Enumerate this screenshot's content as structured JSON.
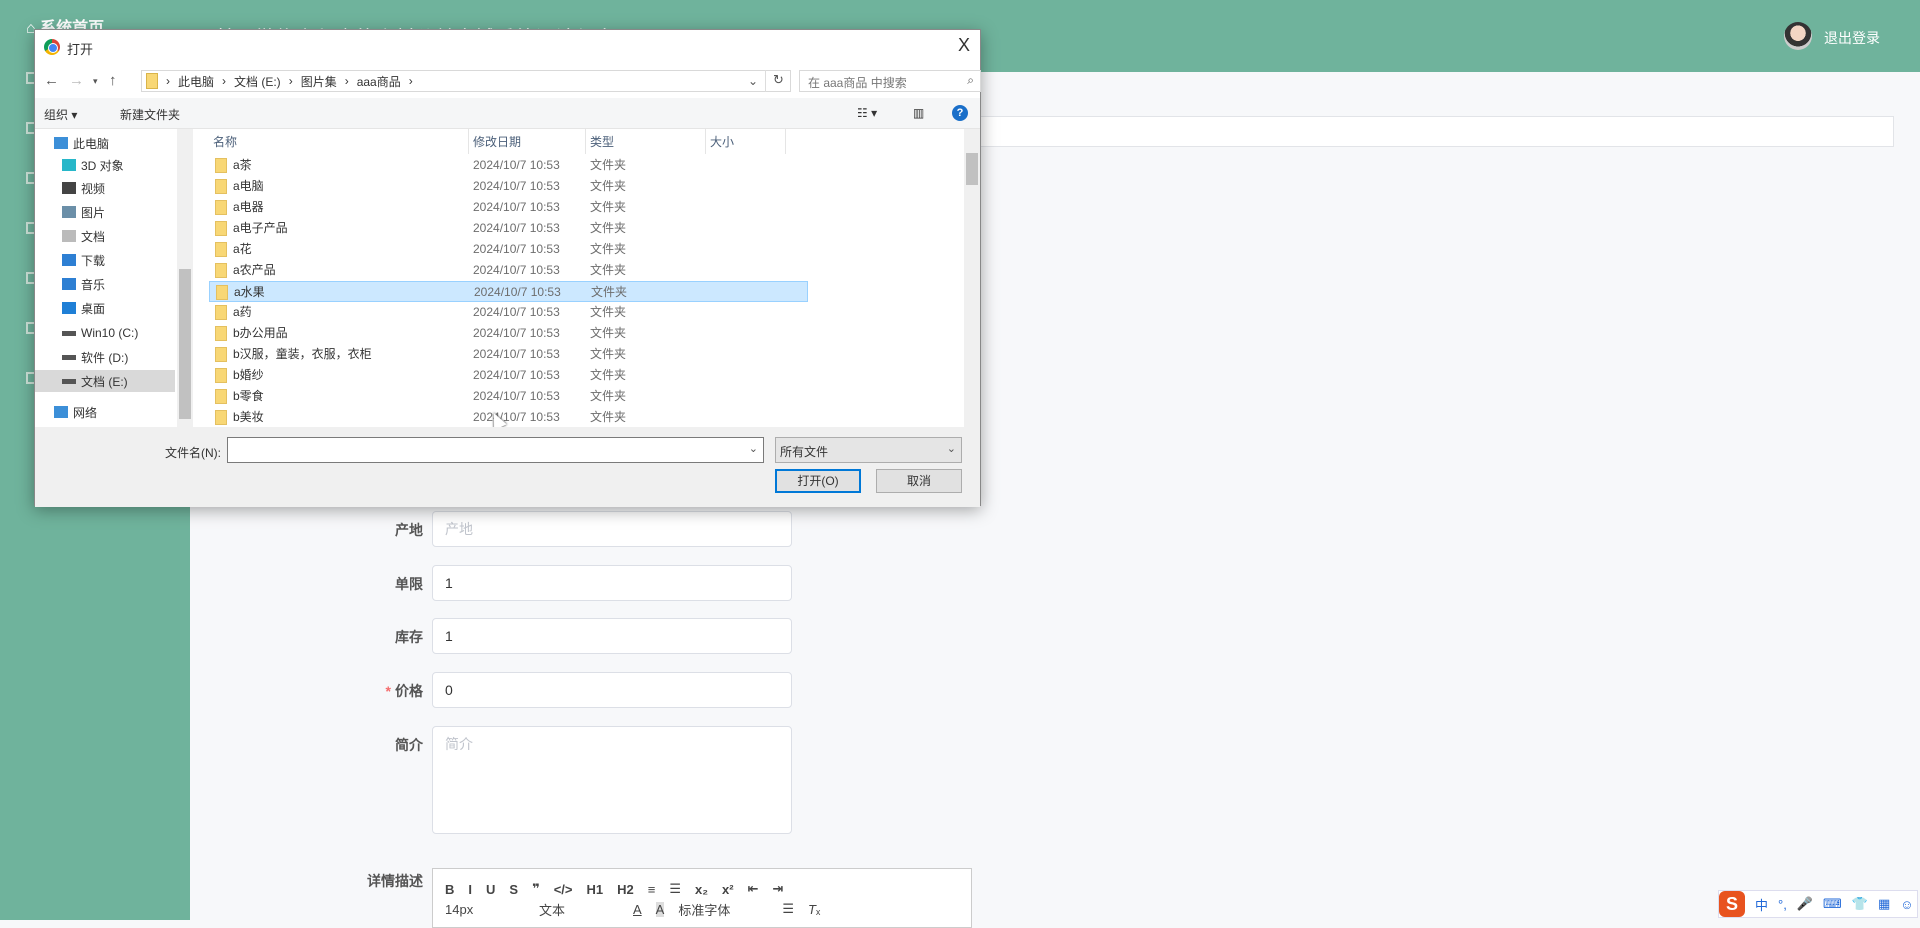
{
  "app": {
    "home_label": "系统首页",
    "title": "基于微信小程序的乡村公益商城系统设计与实现",
    "logout": "退出登录"
  },
  "form": {
    "fields": [
      {
        "label": "产地",
        "value": "",
        "placeholder": "产地",
        "required": false
      },
      {
        "label": "单限",
        "value": "1",
        "placeholder": "",
        "required": false
      },
      {
        "label": "库存",
        "value": "1",
        "placeholder": "",
        "required": false
      },
      {
        "label": "价格",
        "value": "0",
        "placeholder": "",
        "required": true
      },
      {
        "label": "简介",
        "value": "",
        "placeholder": "简介",
        "required": false
      }
    ],
    "required_mark": "*",
    "detail_label": "详情描述",
    "editor": {
      "row1": [
        "B",
        "I",
        "U",
        "S",
        "❞",
        "</>",
        "H1",
        "H2",
        "≡",
        "☰",
        "x₂",
        "x²",
        "⇤",
        "⇥"
      ],
      "font_size": "14px",
      "block": "文本",
      "font": "标准字体"
    }
  },
  "ime": {
    "logo": "S",
    "items": [
      "中",
      "°,",
      "🎤",
      "⌨",
      "👕",
      "▦",
      "☺"
    ]
  },
  "dialog": {
    "title": "打开",
    "close": "X",
    "breadcrumb": [
      "此电脑",
      "文档 (E:)",
      "图片集",
      "aaa商品"
    ],
    "search_placeholder": "在 aaa商品 中搜索",
    "toolbar": {
      "organize": "组织 ▾",
      "new_folder": "新建文件夹"
    },
    "nav": [
      {
        "label": "此电脑",
        "icon": "computer-icon"
      },
      {
        "label": "3D 对象",
        "icon": "cube-icon"
      },
      {
        "label": "视频",
        "icon": "video-icon"
      },
      {
        "label": "图片",
        "icon": "picture-icon"
      },
      {
        "label": "文档",
        "icon": "document-icon"
      },
      {
        "label": "下载",
        "icon": "download-icon"
      },
      {
        "label": "音乐",
        "icon": "music-icon"
      },
      {
        "label": "桌面",
        "icon": "desktop-icon"
      },
      {
        "label": "Win10 (C:)",
        "icon": "drive-icon"
      },
      {
        "label": "软件 (D:)",
        "icon": "drive-icon"
      },
      {
        "label": "文档 (E:)",
        "icon": "drive-icon",
        "selected": true
      },
      {
        "label": "网络",
        "icon": "network-icon"
      }
    ],
    "columns": [
      "名称",
      "修改日期",
      "类型",
      "大小"
    ],
    "files": [
      {
        "name": "a茶",
        "date": "2024/10/7 10:53",
        "type": "文件夹"
      },
      {
        "name": "a电脑",
        "date": "2024/10/7 10:53",
        "type": "文件夹"
      },
      {
        "name": "a电器",
        "date": "2024/10/7 10:53",
        "type": "文件夹"
      },
      {
        "name": "a电子产品",
        "date": "2024/10/7 10:53",
        "type": "文件夹"
      },
      {
        "name": "a花",
        "date": "2024/10/7 10:53",
        "type": "文件夹"
      },
      {
        "name": "a农产品",
        "date": "2024/10/7 10:53",
        "type": "文件夹"
      },
      {
        "name": "a水果",
        "date": "2024/10/7 10:53",
        "type": "文件夹",
        "selected": true
      },
      {
        "name": "a药",
        "date": "2024/10/7 10:53",
        "type": "文件夹"
      },
      {
        "name": "b办公用品",
        "date": "2024/10/7 10:53",
        "type": "文件夹"
      },
      {
        "name": "b汉服，童装，衣服，衣柜",
        "date": "2024/10/7 10:53",
        "type": "文件夹"
      },
      {
        "name": "b婚纱",
        "date": "2024/10/7 10:53",
        "type": "文件夹"
      },
      {
        "name": "b零食",
        "date": "2024/10/7 10:53",
        "type": "文件夹"
      },
      {
        "name": "b美妆",
        "date": "2024/10/7 10:53",
        "type": "文件夹"
      }
    ],
    "filename_label": "文件名(N):",
    "filename_value": "",
    "filter": "所有文件",
    "open": "打开(O)",
    "cancel": "取消"
  }
}
